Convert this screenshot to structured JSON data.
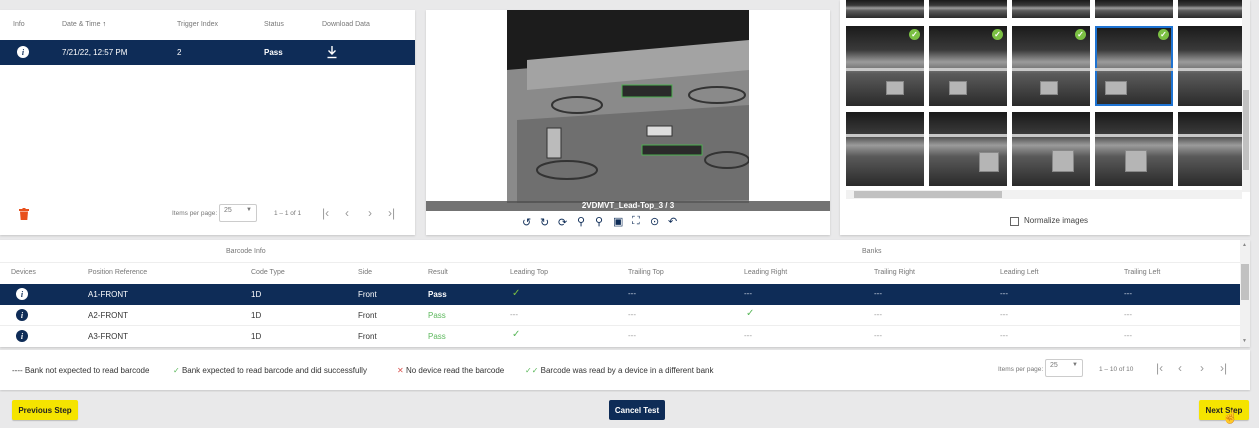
{
  "results_table": {
    "headers": [
      "Info",
      "Date & Time",
      "Trigger Index",
      "Status",
      "Download Data"
    ],
    "sort_arrow": "↑",
    "rows": [
      {
        "date": "7/21/22, 12:57 PM",
        "trigger": "2",
        "status": "Pass"
      }
    ],
    "items_per_page_label": "Items per page:",
    "items_per_page": "25",
    "range": "1 – 1 of 1"
  },
  "image_viewer": {
    "caption": "2VDMVT_Lead-Top_3 / 3",
    "tools": [
      "rotate-ccw-icon",
      "rotate-cw-icon",
      "refresh-icon",
      "zoom-in-icon",
      "zoom-out-icon",
      "fit-image-icon",
      "fullscreen-icon",
      "center-icon",
      "reset-icon"
    ]
  },
  "thumbnails": {
    "normalize_label": "Normalize images"
  },
  "bank_table": {
    "group_barcode": "Barcode Info",
    "group_banks": "Banks",
    "headers": [
      "Devices",
      "Position Reference",
      "Code Type",
      "Side",
      "Result",
      "Leading Top",
      "Trailing Top",
      "Leading Right",
      "Trailing Right",
      "Leading Left",
      "Trailing Left"
    ],
    "rows": [
      {
        "pos": "A1-FRONT",
        "code": "1D",
        "side": "Front",
        "result": "Pass",
        "cells": [
          "✓",
          "---",
          "---",
          "---",
          "---",
          "---"
        ]
      },
      {
        "pos": "A2-FRONT",
        "code": "1D",
        "side": "Front",
        "result": "Pass",
        "cells": [
          "---",
          "---",
          "✓",
          "---",
          "---",
          "---"
        ]
      },
      {
        "pos": "A3-FRONT",
        "code": "1D",
        "side": "Front",
        "result": "Pass",
        "cells": [
          "✓",
          "---",
          "---",
          "---",
          "---",
          "---"
        ]
      }
    ]
  },
  "legend": {
    "not_expected": "---- Bank not expected to read barcode",
    "expected": "Bank expected to read barcode and did successfully",
    "no_device": "No device read the barcode",
    "different_bank": "Barcode was read by a device in a different bank",
    "items_per_page_label": "Items per page:",
    "items_per_page": "25",
    "range": "1 – 10 of 10"
  },
  "footer": {
    "previous": "Previous Step",
    "cancel": "Cancel Test",
    "next": "Next Step"
  },
  "colors": {
    "navy": "#0e2c57",
    "accent_yellow": "#f5e400",
    "success_green": "#5cb85c",
    "error_red": "#d9534f",
    "delete_orange": "#e8501c"
  }
}
